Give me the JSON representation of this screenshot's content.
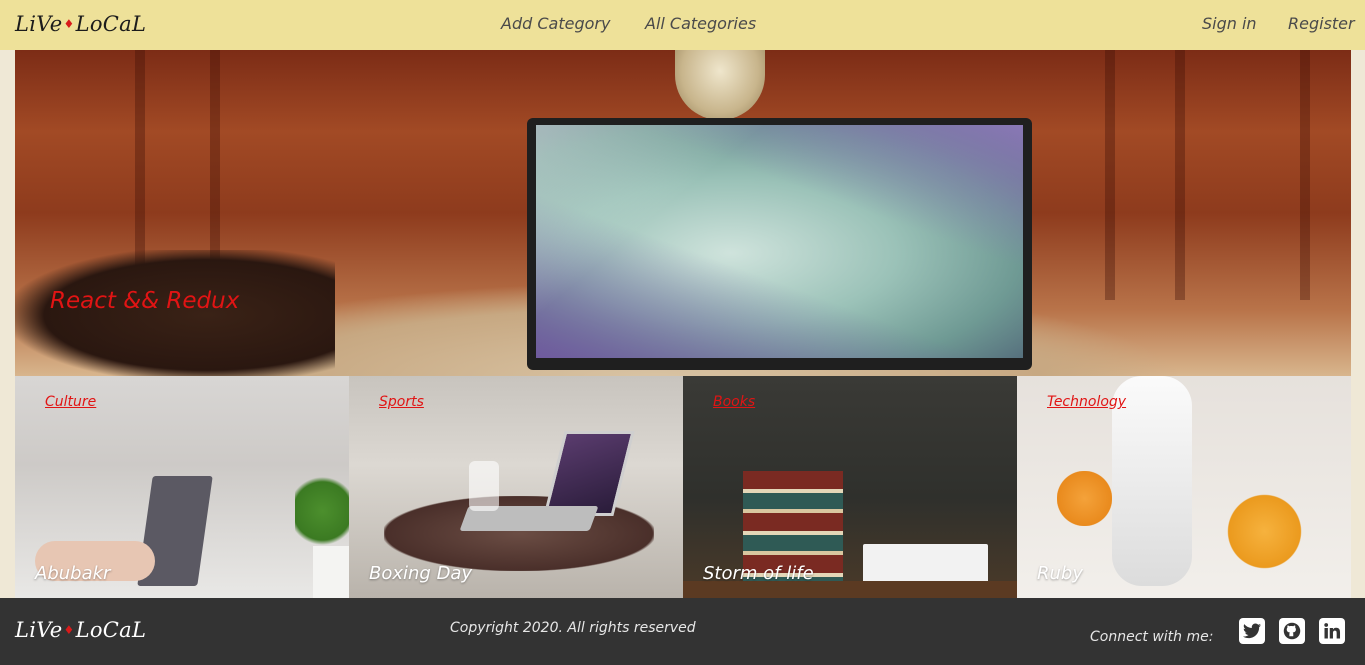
{
  "brand": {
    "name_left": "LiVe",
    "diamond": "♦",
    "name_right": "LoCaL"
  },
  "nav": {
    "add_category": "Add Category",
    "all_categories": "All Categories",
    "sign_in": "Sign in",
    "register": "Register"
  },
  "hero": {
    "title": "React && Redux",
    "title_color": "#e11414"
  },
  "categories": [
    {
      "name": "Culture",
      "article": "Abubakr"
    },
    {
      "name": "Sports",
      "article": "Boxing Day"
    },
    {
      "name": "Books",
      "article": "Storm of life"
    },
    {
      "name": "Technology",
      "article": "Ruby"
    }
  ],
  "footer": {
    "copyright": "Copyright 2020. All rights reserved",
    "connect": "Connect with me:",
    "social": [
      {
        "icon": "twitter-icon",
        "glyph": "🐦"
      },
      {
        "icon": "github-icon",
        "glyph": "◉"
      },
      {
        "icon": "linkedin-icon",
        "glyph": "in"
      }
    ]
  },
  "colors": {
    "header_bg": "#eee199",
    "footer_bg": "#333333",
    "accent": "#e11414"
  }
}
